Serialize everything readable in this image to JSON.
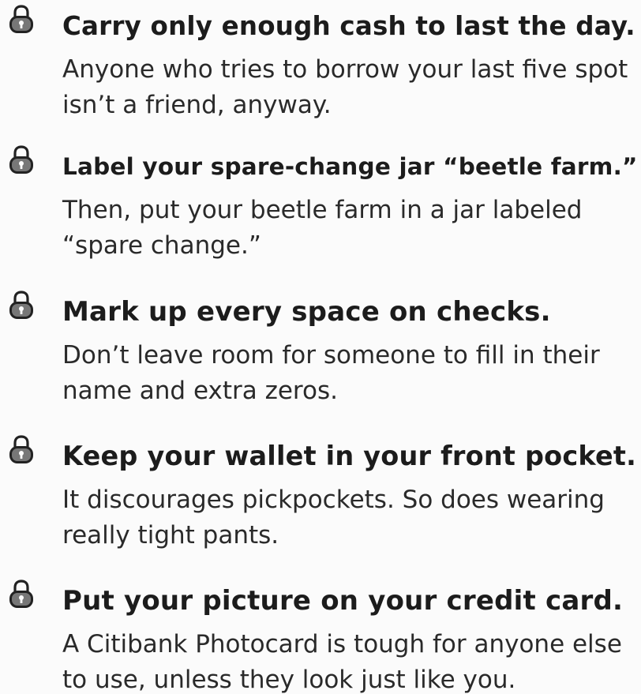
{
  "tips": [
    {
      "icon": "padlock-icon",
      "title": "Carry only enough cash to last the day.",
      "body": "Anyone who tries to borrow your last five spot isn’t a friend, anyway."
    },
    {
      "icon": "padlock-icon",
      "title": "Label your spare-change jar “beetle farm.”",
      "body": "Then, put your beetle farm in a jar labeled “spare change.”"
    },
    {
      "icon": "padlock-icon",
      "title": "Mark up every space on checks.",
      "body": "Don’t leave room for someone to fill in their name and extra zeros."
    },
    {
      "icon": "padlock-icon",
      "title": "Keep your wallet in your front pocket.",
      "body": "It discourages pickpockets. So does wearing really tight pants."
    },
    {
      "icon": "padlock-icon",
      "title": "Put your picture on your credit card.",
      "body": "A Citibank Photocard is tough for anyone else to use, unless they look just like you."
    }
  ]
}
